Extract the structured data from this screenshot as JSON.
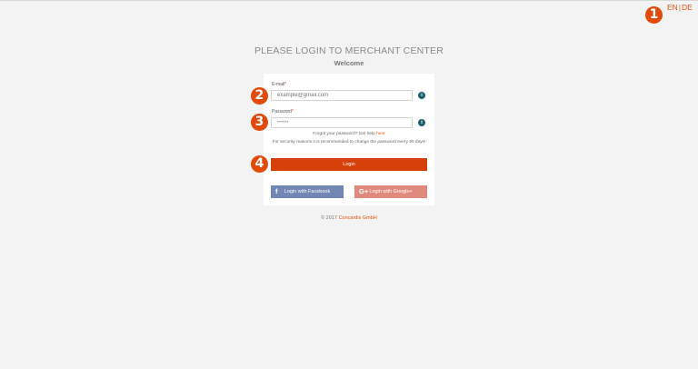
{
  "language": {
    "options": [
      "EN",
      "DE"
    ],
    "separator": "|"
  },
  "markers": [
    "1",
    "2",
    "3",
    "4"
  ],
  "page": {
    "heading": "PLEASE LOGIN TO MERCHANT CENTER",
    "subheading": "Welcome"
  },
  "form": {
    "email": {
      "label": "E-mail",
      "required_mark": "*",
      "placeholder": "example@gmail.com"
    },
    "password": {
      "label": "Password",
      "required_mark": "*",
      "value": "••••••"
    },
    "info_icon_glyph": "i",
    "forgot_text": "Forgot your password? Get help",
    "forgot_link": "here",
    "security_note": "For security reasons it is recommended to change the password every 90 days!",
    "login_label": "Login"
  },
  "social": {
    "facebook": {
      "label": "Login with Facebook",
      "icon": "f"
    },
    "google": {
      "label": "Login with Google+",
      "icon": "G+"
    }
  },
  "footer": {
    "copyright": "© 2017",
    "company": "Concardis GmbH"
  },
  "colors": {
    "accent": "#e8500e",
    "login_button": "#d6410b",
    "facebook": "#7287b3",
    "google": "#e08a7e",
    "info_icon": "#1e5f6d",
    "marker": "#e24a0a"
  }
}
